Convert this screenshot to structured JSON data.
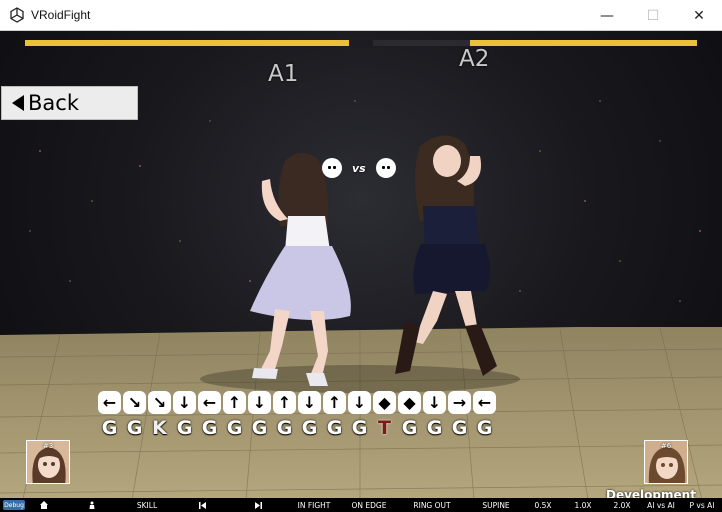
{
  "window": {
    "title": "VRoidFight",
    "minimize": "—",
    "maximize": "☐",
    "close": "✕"
  },
  "hud": {
    "player1": {
      "name": "A1",
      "hp_fraction": 1.0
    },
    "player2": {
      "name": "A2",
      "hp_fraction": 0.7
    },
    "back_label": "Back",
    "vs_label": "vs",
    "portrait1_label": "#3",
    "portrait2_label": "#6",
    "dev_build": "Development Build"
  },
  "input_history": {
    "arrows": [
      "left",
      "down-right",
      "down-right",
      "down",
      "left",
      "up",
      "down",
      "up",
      "down",
      "up",
      "down",
      "diamond",
      "diamond",
      "down",
      "right",
      "left"
    ],
    "keys": [
      "G",
      "G",
      "K",
      "G",
      "G",
      "G",
      "G",
      "G",
      "G",
      "G",
      "G",
      "T",
      "G",
      "G",
      "G",
      "G"
    ]
  },
  "bottom_bar": {
    "debug": "Debug",
    "home_icon": "home-icon",
    "person_icon": "person-icon",
    "skill": "SKILL",
    "prev_icon": "prev-icon",
    "next_icon": "next-icon",
    "in_fight": "IN FIGHT",
    "on_edge": "ON EDGE",
    "ring_out": "RING OUT",
    "supine": "SUPINE",
    "speed_05": "0.5X",
    "speed_10": "1.0X",
    "speed_20": "2.0X",
    "ai_vs_ai": "AI vs AI",
    "p_vs_ai": "P vs AI"
  },
  "colors": {
    "hp": "#e8c23a",
    "hp_empty": "#2b2b2f",
    "floor": "#a89a6e"
  }
}
